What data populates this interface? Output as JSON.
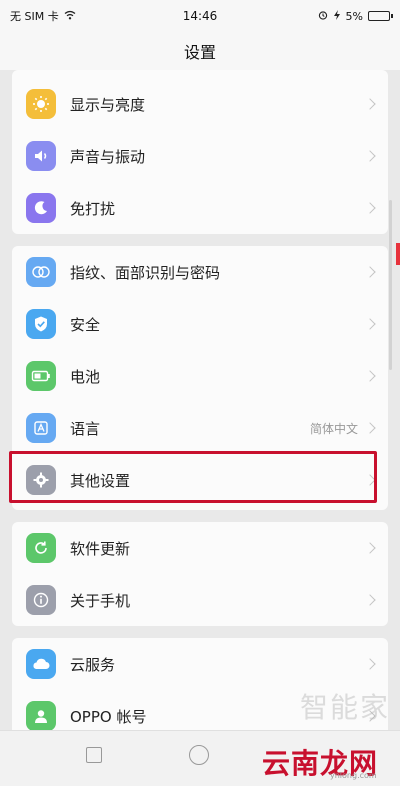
{
  "status": {
    "carrier": "无 SIM 卡",
    "time": "14:46",
    "battery": "5%"
  },
  "title": "设置",
  "groups": [
    {
      "items": [
        {
          "label": "显示与亮度",
          "icon": "brightness-icon",
          "color": "#f4be3a"
        },
        {
          "label": "声音与振动",
          "icon": "speaker-icon",
          "color": "#8a8df0"
        },
        {
          "label": "免打扰",
          "icon": "moon-icon",
          "color": "#8a76ee"
        }
      ]
    },
    {
      "items": [
        {
          "label": "指纹、面部识别与密码",
          "icon": "fingerprint-face-icon",
          "color": "#66a9f2"
        },
        {
          "label": "安全",
          "icon": "shield-icon",
          "color": "#4aa8f0"
        },
        {
          "label": "电池",
          "icon": "battery-icon",
          "color": "#5cc76a"
        },
        {
          "label": "语言",
          "icon": "language-icon",
          "color": "#66a9f2",
          "value": "简体中文"
        },
        {
          "label": "其他设置",
          "icon": "gear-icon",
          "color": "#9c9fab"
        }
      ]
    },
    {
      "items": [
        {
          "label": "软件更新",
          "icon": "refresh-icon",
          "color": "#5cc76a"
        },
        {
          "label": "关于手机",
          "icon": "info-icon",
          "color": "#9c9fab"
        }
      ]
    },
    {
      "items": [
        {
          "label": "云服务",
          "icon": "cloud-icon",
          "color": "#4aa8f0"
        },
        {
          "label": "OPPO 帐号",
          "icon": "account-icon",
          "color": "#5cc76a"
        }
      ]
    }
  ],
  "watermark": {
    "top": "智能家",
    "bottom": "云南龙网",
    "small": "ynlong.com"
  }
}
